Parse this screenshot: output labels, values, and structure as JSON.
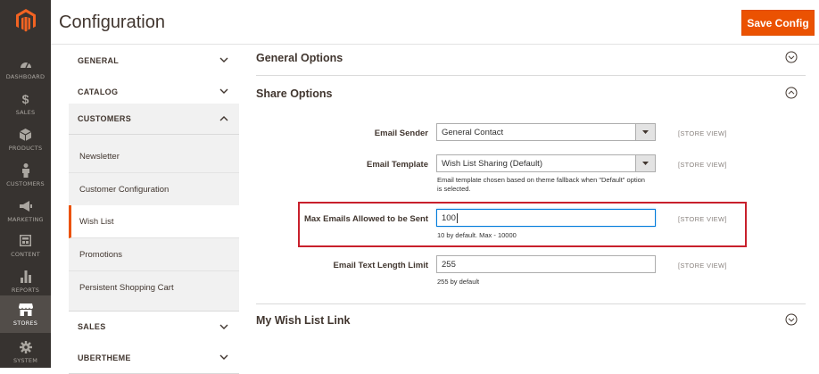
{
  "nav": {
    "items": [
      {
        "label": "DASHBOARD",
        "icon": "dashboard-icon"
      },
      {
        "label": "SALES",
        "icon": "dollar-icon"
      },
      {
        "label": "PRODUCTS",
        "icon": "cube-icon"
      },
      {
        "label": "CUSTOMERS",
        "icon": "person-icon"
      },
      {
        "label": "MARKETING",
        "icon": "megaphone-icon"
      },
      {
        "label": "CONTENT",
        "icon": "layout-icon"
      },
      {
        "label": "REPORTS",
        "icon": "bar-chart-icon"
      },
      {
        "label": "STORES",
        "icon": "storefront-icon",
        "active": true
      },
      {
        "label": "SYSTEM",
        "icon": "gear-icon"
      }
    ]
  },
  "header": {
    "title": "Configuration",
    "save_label": "Save Config"
  },
  "tabs": {
    "groups": [
      {
        "label": "GENERAL",
        "expanded": false
      },
      {
        "label": "CATALOG",
        "expanded": false
      },
      {
        "label": "CUSTOMERS",
        "expanded": true
      },
      {
        "label": "SALES",
        "expanded": false
      },
      {
        "label": "UBERTHEME",
        "expanded": false
      }
    ],
    "customer_items": [
      {
        "label": "Newsletter"
      },
      {
        "label": "Customer Configuration"
      },
      {
        "label": "Wish List",
        "active": true
      },
      {
        "label": "Promotions"
      },
      {
        "label": "Persistent Shopping Cart"
      }
    ]
  },
  "main": {
    "sections": [
      {
        "title": "General Options",
        "expanded": false
      },
      {
        "title": "Share Options",
        "expanded": true
      },
      {
        "title": "My Wish List Link",
        "expanded": false
      }
    ],
    "fields": {
      "email_sender": {
        "label": "Email Sender",
        "value": "General Contact",
        "scope": "[STORE VIEW]"
      },
      "email_template": {
        "label": "Email Template",
        "value": "Wish List Sharing (Default)",
        "scope": "[STORE VIEW]",
        "note": "Email template chosen based on theme fallback when \"Default\" option is selected."
      },
      "max_emails": {
        "label": "Max Emails Allowed to be Sent",
        "value": "100",
        "scope": "[STORE VIEW]",
        "note": "10 by default. Max - 10000"
      },
      "text_length": {
        "label": "Email Text Length Limit",
        "value": "255",
        "scope": "[STORE VIEW]",
        "note": "255 by default"
      }
    }
  },
  "colors": {
    "accent": "#eb5202",
    "nav_bg": "#373330",
    "highlight": "#c8202c"
  }
}
